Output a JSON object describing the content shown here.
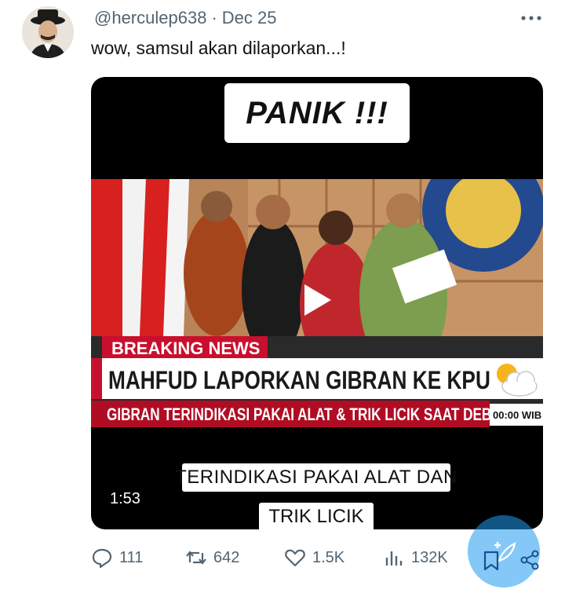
{
  "tweet": {
    "handle": "@herculep638",
    "separator": "·",
    "date": "Dec 25",
    "text": "wow, samsul akan dilaporkan...!"
  },
  "media": {
    "overlay_top": "PANIK !!!",
    "breaking_label": "BREAKING NEWS",
    "headline": "MAHFUD LAPORKAN GIBRAN KE KPU",
    "subline": "GIBRAN TERINDIKASI PAKAI ALAT & TRIK LICIK SAAT DEBAT",
    "clock": "00:00 WIB",
    "caption_line1": "TERINDIKASI PAKAI ALAT DAN",
    "caption_line2": "TRIK LICIK",
    "duration": "1:53",
    "accent_red": "#c8102e",
    "icons": [
      "play-icon",
      "weather-icon"
    ]
  },
  "actions": {
    "replies": "111",
    "reposts": "642",
    "likes": "1.5K",
    "views": "132K",
    "icons": [
      "reply-icon",
      "repost-icon",
      "like-icon",
      "views-icon",
      "bookmark-icon",
      "share-icon",
      "compose-icon",
      "more-icon"
    ]
  },
  "colors": {
    "text_secondary": "#536471",
    "fab": "#1d9bf0"
  }
}
